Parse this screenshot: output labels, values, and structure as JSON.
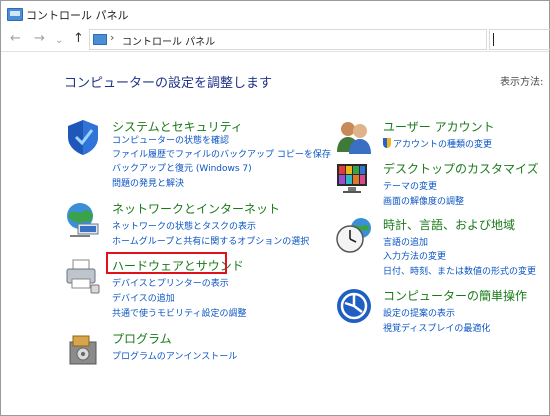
{
  "window": {
    "title": "コントロール パネル"
  },
  "nav": {
    "back": "←",
    "forward": "→",
    "dropdown": "⌄",
    "up": "↑",
    "separator": "›",
    "address": "コントロール パネル",
    "refresh": "↻"
  },
  "main": {
    "heading": "コンピューターの設定を調整します",
    "view_by": "表示方法:"
  },
  "left": [
    {
      "title": "システムとセキュリティ",
      "links": [
        "コンピューターの状態を確認",
        "ファイル履歴でファイルのバックアップ コピーを保存",
        "バックアップと復元 (Windows 7)",
        "問題の発見と解決"
      ]
    },
    {
      "title": "ネットワークとインターネット",
      "links": [
        "ネットワークの状態とタスクの表示",
        "ホームグループと共有に関するオプションの選択"
      ]
    },
    {
      "title": "ハードウェアとサウンド",
      "links": [
        "デバイスとプリンターの表示",
        "デバイスの追加",
        "共通で使うモビリティ設定の調整"
      ]
    },
    {
      "title": "プログラム",
      "links": [
        "プログラムのアンインストール"
      ]
    }
  ],
  "right": [
    {
      "title": "ユーザー アカウント",
      "links": [
        "アカウントの種類の変更"
      ]
    },
    {
      "title": "デスクトップのカスタマイズ",
      "links": [
        "テーマの変更",
        "画面の解像度の調整"
      ]
    },
    {
      "title": "時計、言語、および地域",
      "links": [
        "言語の追加",
        "入力方法の変更",
        "日付、時刻、または数値の形式の変更"
      ]
    },
    {
      "title": "コンピューターの簡単操作",
      "links": [
        "設定の提案の表示",
        "視覚ディスプレイの最適化"
      ]
    }
  ],
  "colors": {
    "heading": "#1e3287",
    "category_title": "#1a7a1a",
    "link": "#0b55c4",
    "highlight": "#e0111a"
  }
}
